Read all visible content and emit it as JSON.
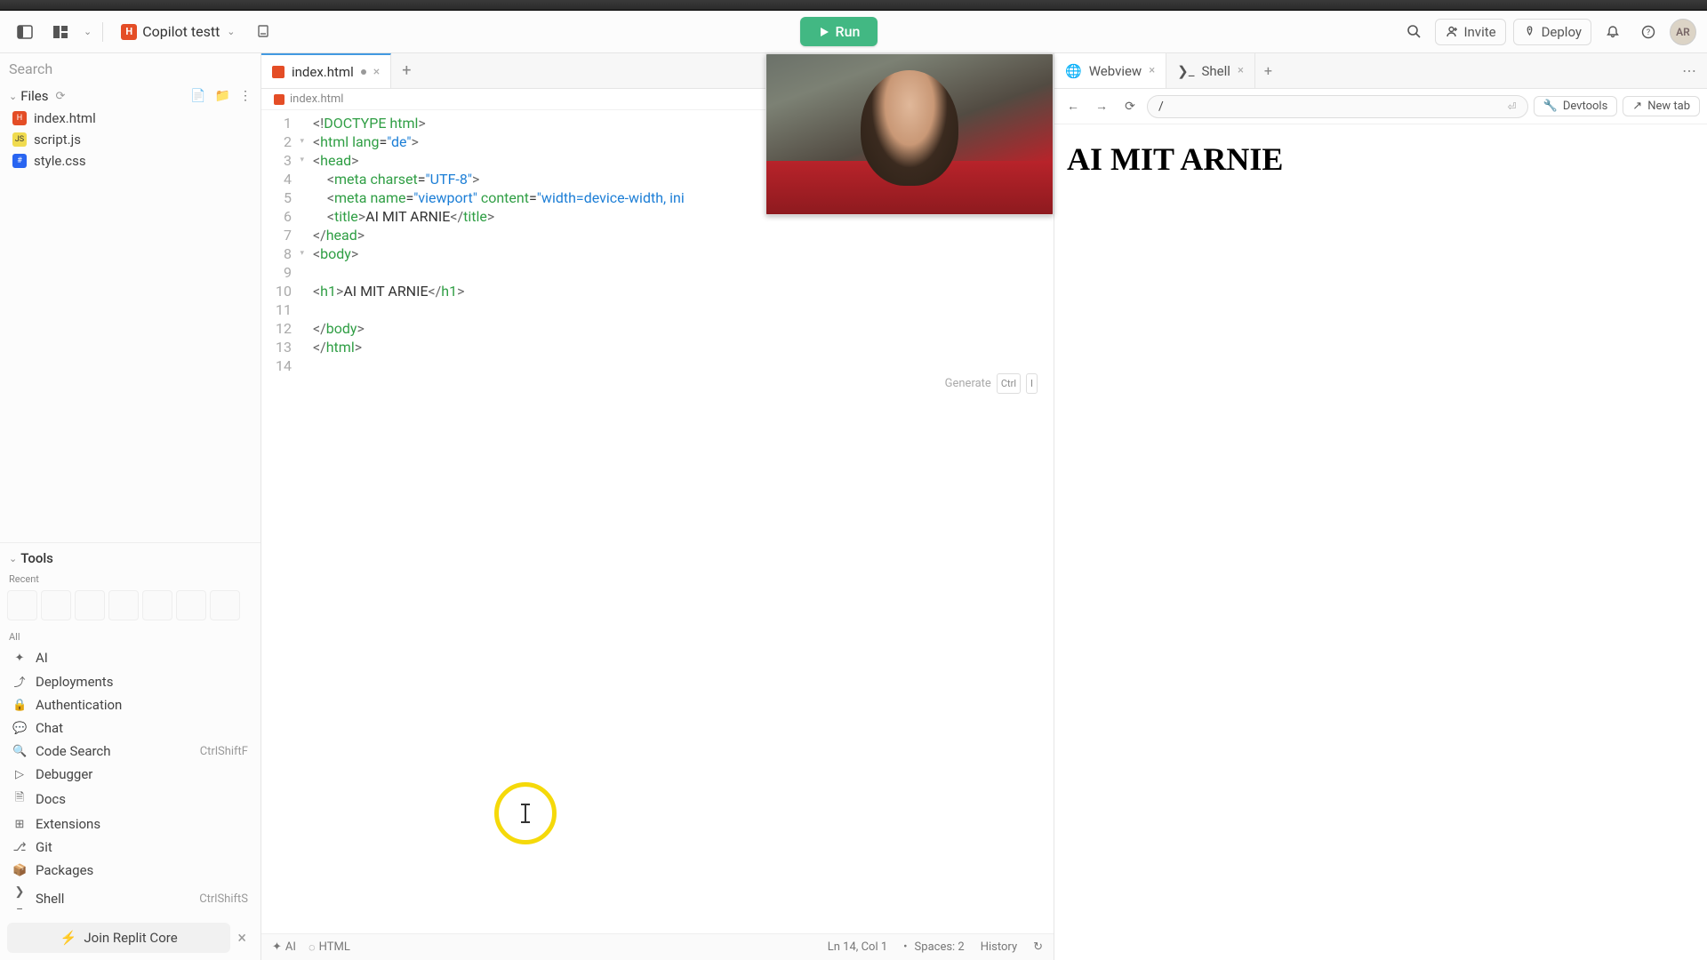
{
  "header": {
    "project_name": "Copilot testt",
    "run_label": "Run",
    "invite_label": "Invite",
    "deploy_label": "Deploy",
    "avatar_initials": "AR"
  },
  "sidebar": {
    "search_placeholder": "Search",
    "files_label": "Files",
    "files": [
      {
        "name": "index.html",
        "type": "html"
      },
      {
        "name": "script.js",
        "type": "js"
      },
      {
        "name": "style.css",
        "type": "css"
      }
    ],
    "tools_label": "Tools",
    "recent_label": "Recent",
    "all_label": "All",
    "tools": [
      {
        "name": "AI",
        "shortcut": ""
      },
      {
        "name": "Deployments",
        "shortcut": ""
      },
      {
        "name": "Authentication",
        "shortcut": ""
      },
      {
        "name": "Chat",
        "shortcut": ""
      },
      {
        "name": "Code Search",
        "shortcut": "CtrlShiftF"
      },
      {
        "name": "Debugger",
        "shortcut": ""
      },
      {
        "name": "Docs",
        "shortcut": ""
      },
      {
        "name": "Extensions",
        "shortcut": ""
      },
      {
        "name": "Git",
        "shortcut": ""
      },
      {
        "name": "Packages",
        "shortcut": ""
      },
      {
        "name": "Shell",
        "shortcut": "CtrlShiftS"
      }
    ],
    "join_label": "Join Replit Core"
  },
  "editor": {
    "tab_label": "index.html",
    "breadcrumb": "index.html",
    "generate_label": "Generate",
    "generate_key1": "Ctrl",
    "generate_key2": "I",
    "lines": [
      "<!DOCTYPE html>",
      "<html lang=\"de\">",
      "<head>",
      "    <meta charset=\"UTF-8\">",
      "    <meta name=\"viewport\" content=\"width=device-width, ini",
      "    <title>AI MIT ARNIE</title>",
      "</head>",
      "<body>",
      "",
      "<h1>AI MIT ARNIE</h1>",
      "",
      "</body>",
      "</html>",
      ""
    ],
    "statusbar": {
      "ai": "AI",
      "lang": "HTML",
      "position": "Ln 14, Col 1",
      "spaces": "Spaces: 2",
      "history": "History"
    }
  },
  "preview": {
    "tab_webview": "Webview",
    "tab_shell": "Shell",
    "url_value": "/",
    "devtools_label": "Devtools",
    "newtab_label": "New tab",
    "heading": "AI MIT ARNIE"
  }
}
